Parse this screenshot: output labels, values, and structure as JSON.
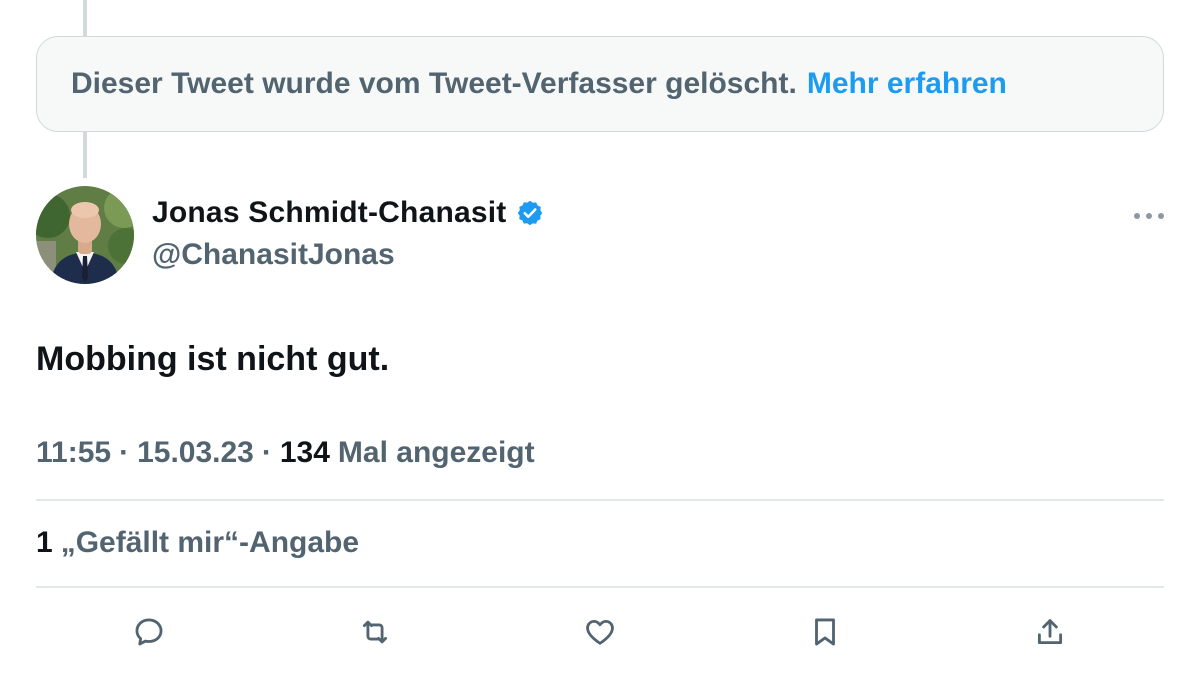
{
  "deleted_notice": {
    "text": "Dieser Tweet wurde vom Tweet-Verfasser gelöscht.",
    "link": "Mehr erfahren"
  },
  "author": {
    "name": "Jonas Schmidt-Chanasit",
    "handle": "@ChanasitJonas",
    "verified": true
  },
  "tweet": {
    "text": "Mobbing ist nicht gut."
  },
  "meta": {
    "time": "11:55",
    "separator": "·",
    "date": "15.03.23",
    "views_count": "134",
    "views_label": "Mal angezeigt"
  },
  "likes": {
    "count": "1",
    "label": "„Gefällt mir“-Angabe"
  },
  "actions": [
    {
      "icon": "reply-icon"
    },
    {
      "icon": "retweet-icon"
    },
    {
      "icon": "like-icon"
    },
    {
      "icon": "bookmark-icon"
    },
    {
      "icon": "share-icon"
    }
  ],
  "colors": {
    "accent": "#1d9bf0",
    "secondary_text": "#536471",
    "primary_text": "#0f1419",
    "border": "#cfd9de"
  }
}
